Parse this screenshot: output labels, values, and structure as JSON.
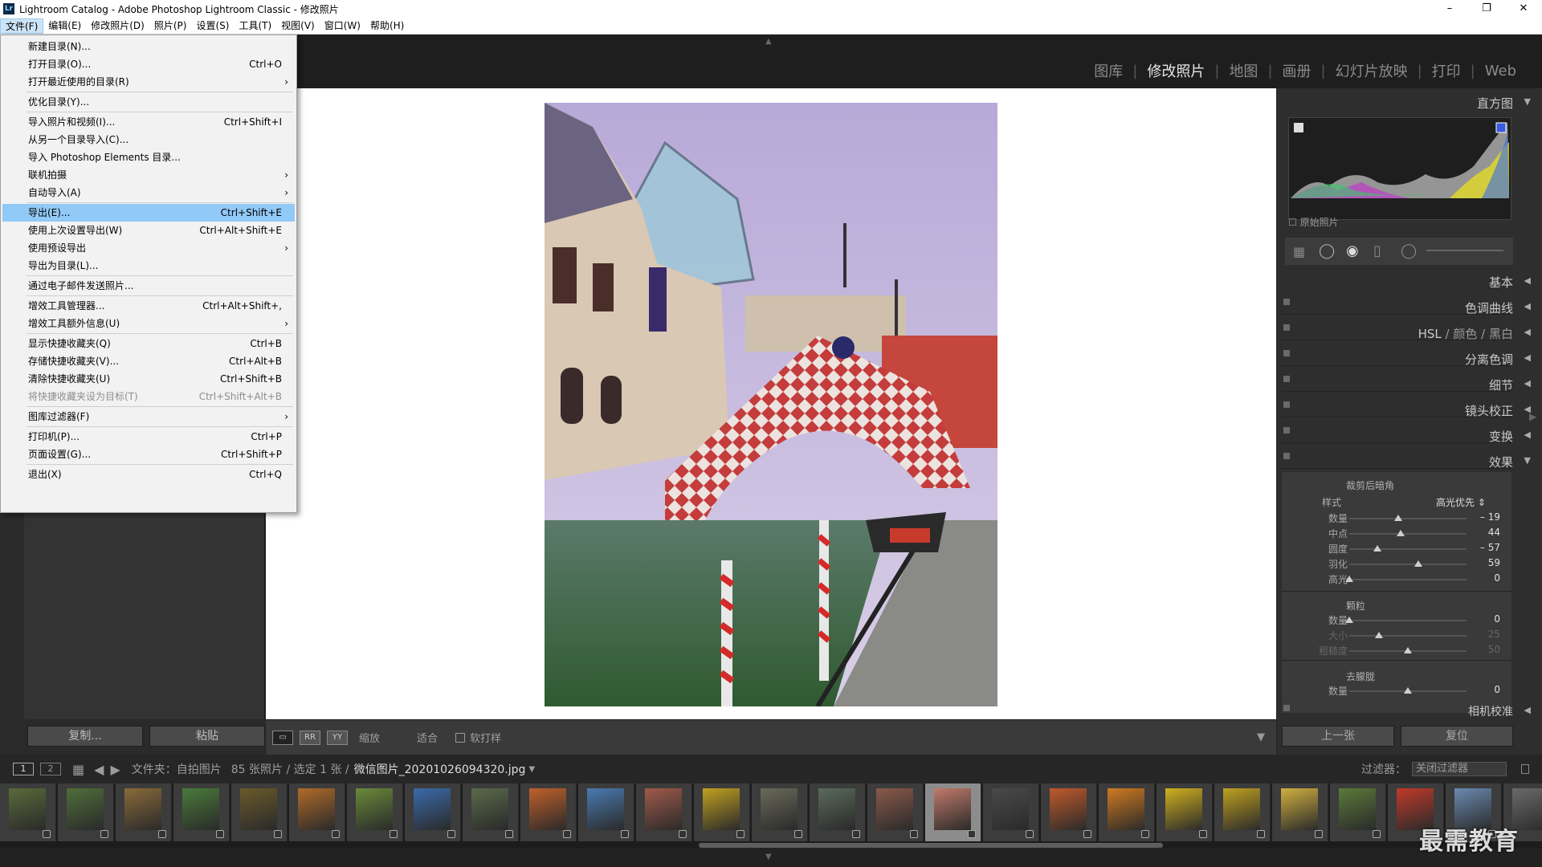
{
  "window": {
    "title": "Lightroom Catalog - Adobe Photoshop Lightroom Classic - 修改照片",
    "icon": "Lr"
  },
  "menubar": [
    "文件(F)",
    "编辑(E)",
    "修改照片(D)",
    "照片(P)",
    "设置(S)",
    "工具(T)",
    "视图(V)",
    "窗口(W)",
    "帮助(H)"
  ],
  "modules": [
    "图库",
    "修改照片",
    "地图",
    "画册",
    "幻灯片放映",
    "打印",
    "Web"
  ],
  "file_menu": [
    {
      "label": "新建目录(N)...",
      "shortcut": ""
    },
    {
      "label": "打开目录(O)...",
      "shortcut": "Ctrl+O"
    },
    {
      "label": "打开最近使用的目录(R)",
      "shortcut": "",
      "submenu": true
    },
    {
      "label": "优化目录(Y)...",
      "shortcut": "",
      "sep_before": true
    },
    {
      "label": "导入照片和视频(I)...",
      "shortcut": "Ctrl+Shift+I",
      "sep_before": true
    },
    {
      "label": "从另一个目录导入(C)...",
      "shortcut": ""
    },
    {
      "label": "导入 Photoshop Elements 目录...",
      "shortcut": ""
    },
    {
      "label": "联机拍摄",
      "shortcut": "",
      "submenu": true
    },
    {
      "label": "自动导入(A)",
      "shortcut": "",
      "submenu": true
    },
    {
      "label": "导出(E)...",
      "shortcut": "Ctrl+Shift+E",
      "sep_before": true,
      "highlight": true
    },
    {
      "label": "使用上次设置导出(W)",
      "shortcut": "Ctrl+Alt+Shift+E"
    },
    {
      "label": "使用预设导出",
      "shortcut": "",
      "submenu": true
    },
    {
      "label": "导出为目录(L)...",
      "shortcut": ""
    },
    {
      "label": "通过电子邮件发送照片...",
      "shortcut": "",
      "sep_before": true
    },
    {
      "label": "增效工具管理器...",
      "shortcut": "Ctrl+Alt+Shift+,",
      "sep_before": true
    },
    {
      "label": "增效工具额外信息(U)",
      "shortcut": "",
      "submenu": true
    },
    {
      "label": "显示快捷收藏夹(Q)",
      "shortcut": "Ctrl+B",
      "sep_before": true
    },
    {
      "label": "存储快捷收藏夹(V)...",
      "shortcut": "Ctrl+Alt+B"
    },
    {
      "label": "清除快捷收藏夹(U)",
      "shortcut": "Ctrl+Shift+B"
    },
    {
      "label": "将快捷收藏夹设为目标(T)",
      "shortcut": "Ctrl+Shift+Alt+B",
      "disabled": true
    },
    {
      "label": "图库过滤器(F)",
      "shortcut": "",
      "submenu": true,
      "sep_before": true
    },
    {
      "label": "打印机(P)...",
      "shortcut": "Ctrl+P",
      "sep_before": true
    },
    {
      "label": "页面设置(G)...",
      "shortcut": "Ctrl+Shift+P"
    },
    {
      "label": "退出(X)",
      "shortcut": "Ctrl+Q",
      "sep_before": true
    }
  ],
  "left_buttons": {
    "copy": "复制...",
    "paste": "粘贴"
  },
  "toolbar": {
    "zoom_label": "缩放",
    "fit_label": "适合",
    "soft_proof": "软打样"
  },
  "right_panel": {
    "histogram": "直方图",
    "original_photo": "原始照片",
    "basic": "基本",
    "tone_curve": "色调曲线",
    "hsl": "HSL",
    "color": "颜色",
    "bw": "黑白",
    "split_toning": "分离色调",
    "detail": "细节",
    "lens_correction": "镜头校正",
    "transform": "变换",
    "effects": "效果",
    "camera_calibration": "相机校准",
    "vignette": {
      "title": "裁剪后暗角",
      "style_label": "样式",
      "style_value": "高光优先",
      "sliders": [
        {
          "label": "数量",
          "value": "– 19",
          "pos": 0.42
        },
        {
          "label": "中点",
          "value": "44",
          "pos": 0.44
        },
        {
          "label": "圆度",
          "value": "– 57",
          "pos": 0.24
        },
        {
          "label": "羽化",
          "value": "59",
          "pos": 0.59
        },
        {
          "label": "高光",
          "value": "0",
          "pos": 0.0
        }
      ]
    },
    "grain": {
      "title": "颗粒",
      "sliders": [
        {
          "label": "数量",
          "value": "0",
          "pos": 0.0
        },
        {
          "label": "大小",
          "value": "25",
          "pos": 0.25,
          "dim": true
        },
        {
          "label": "粗糙度",
          "value": "50",
          "pos": 0.5,
          "dim": true
        }
      ]
    },
    "dehaze": {
      "title": "去朦胧",
      "sliders": [
        {
          "label": "数量",
          "value": "0",
          "pos": 0.5
        }
      ]
    },
    "prev_button": "上一张",
    "reset_button": "复位"
  },
  "filmstrip_bar": {
    "view1": "1",
    "view2": "2",
    "folder": "文件夹：自拍图片",
    "count": "85 张照片 / 选定 1 张 /",
    "filename": "微信图片_20201026094320.jpg",
    "filter_label": "过滤器：",
    "filter_value": "关闭过滤器"
  },
  "filmstrip_colors": [
    "#5a6a3a",
    "#4f6e3a",
    "#8a6a3a",
    "#4a7a3a",
    "#6a5a2a",
    "#b06a2a",
    "#6a8a3a",
    "#3a6aaa",
    "#5a6a4a",
    "#c0602a",
    "#4a7ab0",
    "#a05a4a",
    "#c0a020",
    "#6a6a5a",
    "#5a6a5a",
    "#8a5a4a",
    "#c07a6a",
    "#4a4a4a",
    "#c05a2a",
    "#d07a20",
    "#d0b020",
    "#c0a020",
    "#d0b040",
    "#5a7a3a",
    "#c03a2a",
    "#6a8ab0",
    "#6a6a6a"
  ],
  "watermark": "最需教育"
}
